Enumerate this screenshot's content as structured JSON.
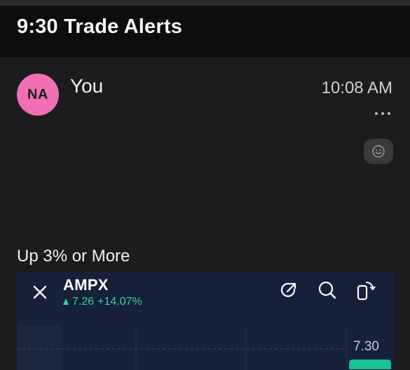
{
  "header": {
    "title": "9:30 Trade Alerts"
  },
  "message": {
    "avatar_initials": "NA",
    "avatar_color": "#f16fb4",
    "sender": "You",
    "timestamp": "10:08 AM",
    "more_icon": "more-horizontal-icon",
    "reaction_icon": "emoji-smile-icon",
    "caption": "Up 3% or More"
  },
  "card": {
    "ticker": "AMPX",
    "price": "7.26",
    "change": "+14.07%",
    "change_color": "#38d39f",
    "axis_price": "7.30",
    "icons": [
      "close-icon",
      "share-icon",
      "search-icon",
      "rotate-icon"
    ]
  }
}
